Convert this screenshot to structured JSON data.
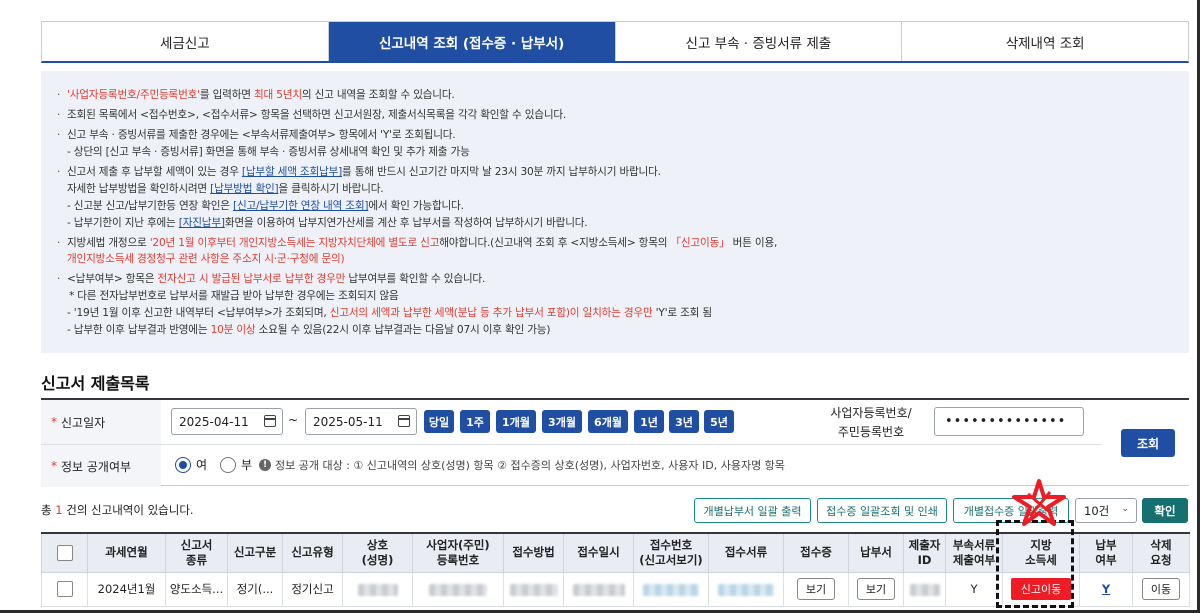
{
  "tabs": [
    {
      "label": "세금신고",
      "active": false
    },
    {
      "label": "신고내역 조회 (접수증 · 납부서)",
      "active": true
    },
    {
      "label": "신고 부속 · 증빙서류 제출",
      "active": false
    },
    {
      "label": "삭제내역 조회",
      "active": false
    }
  ],
  "notice": {
    "l1_a": "'사업자등록번호/주민등록번호'",
    "l1_b": "를 입력하면 ",
    "l1_c": "최대 5년치",
    "l1_d": "의 신고 내역을 조회할 수 있습니다.",
    "l2": "조회된 목록에서 <접수번호>, <접수서류> 항목을 선택하면 신고서원장, 제출서식목록을 각각 확인할 수 있습니다.",
    "l3": "신고 부속 · 증빙서류를 제출한 경우에는 <부속서류제출여부> 항목에서 'Y'로 조회됩니다.",
    "l4": "- 상단의 [신고 부속 · 증빙서류] 화면을 통해 부속 · 증빙서류 상세내역 확인 및 추가 제출 가능",
    "l5_a": "신고서 제출 후 납부할 세액이 있는 경우 ",
    "l5_link": "[납부할 세액 조회납부]",
    "l5_b": "를 통해 반드시 신고기간 마지막 날 23시 30분 까지 납부하시기 바랍니다.",
    "l6_a": "자세한 납부방법을 확인하시려면 ",
    "l6_link": "[납부방법 확인]",
    "l6_b": "을 클릭하시기 바랍니다.",
    "l7_a": "- 신고분 신고/납부기한등 연장 확인은 ",
    "l7_link": "[신고/납부기한 연장 내역 조회]",
    "l7_b": "에서 확인 가능합니다.",
    "l8_a": "- 납부기한이 지난 후에는 ",
    "l8_link": "[자진납부]",
    "l8_b": "화면을 이용하여 납부지연가산세를 계산 후 납부서를 작성하여 납부하시기 바랍니다.",
    "l9_a": "지방세법 개정으로 ",
    "l9_red": "'20년 1월 이후부터 개인지방소득세는 지방자치단체에 별도로 신고",
    "l9_b": "해야합니다.(신고내역 조회 후 <지방소득세> 항목의 ",
    "l9_red2": "「신고이동」",
    "l9_c": " 버튼 이용,",
    "l10": "개인지방소득세 경정청구 관련 사항은 주소지 시·군·구청에 문의)",
    "l11_a": "<납부여부> 항목은 ",
    "l11_red": "전자신고 시 발급된 납부서로 납부한 경우만",
    "l11_b": " 납부여부를 확인할 수 있습니다.",
    "l12": "* 다른 전자납부번호로 납부서를 재발급 받아 납부한 경우에는 조회되지 않음",
    "l13_a": "- '19년 1월 이후 신고한 내역부터 <납부여부>가 조회되며, ",
    "l13_red": "신고서의 세액과 납부한 세액(분납 등 추가 납부서 포함)이 일치하는 경우만",
    "l13_b": " 'Y'로 조회 됨",
    "l14_a": "- 납부한 이후 납부결과 반영에는 ",
    "l14_red": "10분 이상",
    "l14_b": " 소요될 수 있음(22시 이후 납부결과는 다음날 07시 이후 확인 가능)"
  },
  "section_title": "신고서 제출목록",
  "search": {
    "date_label": "신고일자",
    "date_from": "2025-04-11",
    "date_sep": "~",
    "date_to": "2025-05-11",
    "periods": [
      "당일",
      "1주",
      "1개월",
      "3개월",
      "6개월",
      "1년",
      "3년",
      "5년"
    ],
    "biz_label_1": "사업자등록번호/",
    "biz_label_2": "주민등록번호",
    "biz_value": "••••••••••••••",
    "query_label": "조회",
    "disclose_label": "정보 공개여부",
    "radio_yes": "여",
    "radio_no": "부",
    "disclose_info": "정보 공개 대상 : ① 신고내역의 상호(성명) 항목 ② 접수증의 상호(성명), 사업자번호, 사용자 ID, 사용자명 항목"
  },
  "results": {
    "count_prefix": "총 ",
    "count": "1",
    "count_suffix": " 건의 신고내역이 있습니다.",
    "btn_payment_print": "개별납부서 일괄 출력",
    "btn_receipt_print": "접수증 일괄조회 및 인쇄",
    "btn_individual": "개별접수증 일괄출력",
    "page_size": "10건",
    "confirm": "확인"
  },
  "table": {
    "headers": [
      [
        "과세연월"
      ],
      [
        "신고서",
        "종류"
      ],
      [
        "신고구분"
      ],
      [
        "신고유형"
      ],
      [
        "상호",
        "(성명)"
      ],
      [
        "사업자(주민)",
        "등록번호"
      ],
      [
        "접수방법"
      ],
      [
        "접수일시"
      ],
      [
        "접수번호",
        "(신고서보기)"
      ],
      [
        "접수서류"
      ],
      [
        "접수증"
      ],
      [
        "납부서"
      ],
      [
        "제출자",
        "ID"
      ],
      [
        "부속서류",
        "제출여부"
      ],
      [
        "지방",
        "소득세"
      ],
      [
        "납부",
        "여부"
      ],
      [
        "삭제",
        "요청"
      ]
    ],
    "row": {
      "period": "2024년1월",
      "type": "양도소득...",
      "category": "정기(...",
      "kind": "정기신고",
      "receipt_btn": "보기",
      "payment_btn": "보기",
      "attach_submitted": "Y",
      "local_tax_btn": "신고이동",
      "paid": "Y",
      "delete_btn": "이동"
    }
  },
  "colors": {
    "primary": "#1f4ea3",
    "teal": "#16706f",
    "red": "#e03c31",
    "alert_red": "#ee1c24"
  }
}
